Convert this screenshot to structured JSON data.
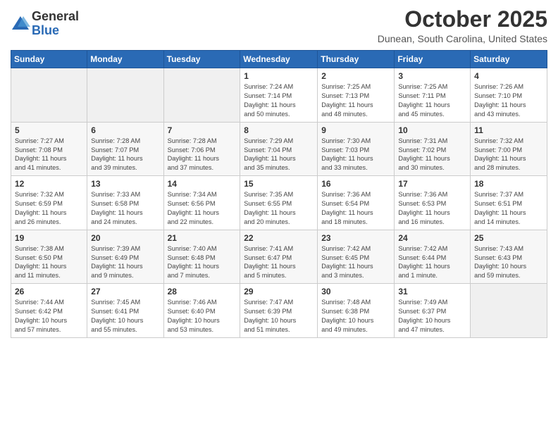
{
  "header": {
    "logo_general": "General",
    "logo_blue": "Blue",
    "month_title": "October 2025",
    "location": "Dunean, South Carolina, United States"
  },
  "days_of_week": [
    "Sunday",
    "Monday",
    "Tuesday",
    "Wednesday",
    "Thursday",
    "Friday",
    "Saturday"
  ],
  "weeks": [
    [
      {
        "day": "",
        "info": ""
      },
      {
        "day": "",
        "info": ""
      },
      {
        "day": "",
        "info": ""
      },
      {
        "day": "1",
        "info": "Sunrise: 7:24 AM\nSunset: 7:14 PM\nDaylight: 11 hours\nand 50 minutes."
      },
      {
        "day": "2",
        "info": "Sunrise: 7:25 AM\nSunset: 7:13 PM\nDaylight: 11 hours\nand 48 minutes."
      },
      {
        "day": "3",
        "info": "Sunrise: 7:25 AM\nSunset: 7:11 PM\nDaylight: 11 hours\nand 45 minutes."
      },
      {
        "day": "4",
        "info": "Sunrise: 7:26 AM\nSunset: 7:10 PM\nDaylight: 11 hours\nand 43 minutes."
      }
    ],
    [
      {
        "day": "5",
        "info": "Sunrise: 7:27 AM\nSunset: 7:08 PM\nDaylight: 11 hours\nand 41 minutes."
      },
      {
        "day": "6",
        "info": "Sunrise: 7:28 AM\nSunset: 7:07 PM\nDaylight: 11 hours\nand 39 minutes."
      },
      {
        "day": "7",
        "info": "Sunrise: 7:28 AM\nSunset: 7:06 PM\nDaylight: 11 hours\nand 37 minutes."
      },
      {
        "day": "8",
        "info": "Sunrise: 7:29 AM\nSunset: 7:04 PM\nDaylight: 11 hours\nand 35 minutes."
      },
      {
        "day": "9",
        "info": "Sunrise: 7:30 AM\nSunset: 7:03 PM\nDaylight: 11 hours\nand 33 minutes."
      },
      {
        "day": "10",
        "info": "Sunrise: 7:31 AM\nSunset: 7:02 PM\nDaylight: 11 hours\nand 30 minutes."
      },
      {
        "day": "11",
        "info": "Sunrise: 7:32 AM\nSunset: 7:00 PM\nDaylight: 11 hours\nand 28 minutes."
      }
    ],
    [
      {
        "day": "12",
        "info": "Sunrise: 7:32 AM\nSunset: 6:59 PM\nDaylight: 11 hours\nand 26 minutes."
      },
      {
        "day": "13",
        "info": "Sunrise: 7:33 AM\nSunset: 6:58 PM\nDaylight: 11 hours\nand 24 minutes."
      },
      {
        "day": "14",
        "info": "Sunrise: 7:34 AM\nSunset: 6:56 PM\nDaylight: 11 hours\nand 22 minutes."
      },
      {
        "day": "15",
        "info": "Sunrise: 7:35 AM\nSunset: 6:55 PM\nDaylight: 11 hours\nand 20 minutes."
      },
      {
        "day": "16",
        "info": "Sunrise: 7:36 AM\nSunset: 6:54 PM\nDaylight: 11 hours\nand 18 minutes."
      },
      {
        "day": "17",
        "info": "Sunrise: 7:36 AM\nSunset: 6:53 PM\nDaylight: 11 hours\nand 16 minutes."
      },
      {
        "day": "18",
        "info": "Sunrise: 7:37 AM\nSunset: 6:51 PM\nDaylight: 11 hours\nand 14 minutes."
      }
    ],
    [
      {
        "day": "19",
        "info": "Sunrise: 7:38 AM\nSunset: 6:50 PM\nDaylight: 11 hours\nand 11 minutes."
      },
      {
        "day": "20",
        "info": "Sunrise: 7:39 AM\nSunset: 6:49 PM\nDaylight: 11 hours\nand 9 minutes."
      },
      {
        "day": "21",
        "info": "Sunrise: 7:40 AM\nSunset: 6:48 PM\nDaylight: 11 hours\nand 7 minutes."
      },
      {
        "day": "22",
        "info": "Sunrise: 7:41 AM\nSunset: 6:47 PM\nDaylight: 11 hours\nand 5 minutes."
      },
      {
        "day": "23",
        "info": "Sunrise: 7:42 AM\nSunset: 6:45 PM\nDaylight: 11 hours\nand 3 minutes."
      },
      {
        "day": "24",
        "info": "Sunrise: 7:42 AM\nSunset: 6:44 PM\nDaylight: 11 hours\nand 1 minute."
      },
      {
        "day": "25",
        "info": "Sunrise: 7:43 AM\nSunset: 6:43 PM\nDaylight: 10 hours\nand 59 minutes."
      }
    ],
    [
      {
        "day": "26",
        "info": "Sunrise: 7:44 AM\nSunset: 6:42 PM\nDaylight: 10 hours\nand 57 minutes."
      },
      {
        "day": "27",
        "info": "Sunrise: 7:45 AM\nSunset: 6:41 PM\nDaylight: 10 hours\nand 55 minutes."
      },
      {
        "day": "28",
        "info": "Sunrise: 7:46 AM\nSunset: 6:40 PM\nDaylight: 10 hours\nand 53 minutes."
      },
      {
        "day": "29",
        "info": "Sunrise: 7:47 AM\nSunset: 6:39 PM\nDaylight: 10 hours\nand 51 minutes."
      },
      {
        "day": "30",
        "info": "Sunrise: 7:48 AM\nSunset: 6:38 PM\nDaylight: 10 hours\nand 49 minutes."
      },
      {
        "day": "31",
        "info": "Sunrise: 7:49 AM\nSunset: 6:37 PM\nDaylight: 10 hours\nand 47 minutes."
      },
      {
        "day": "",
        "info": ""
      }
    ]
  ]
}
